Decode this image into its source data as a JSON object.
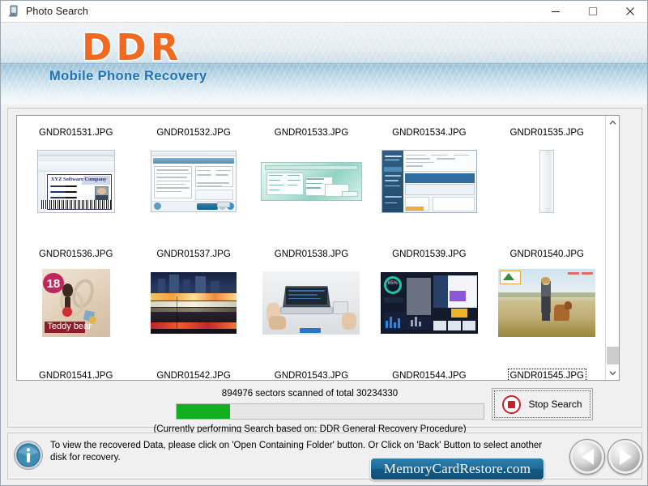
{
  "window": {
    "title": "Photo Search",
    "icon": "photo-search-app-icon",
    "controls": {
      "minimize": "minimize-icon",
      "maximize": "maximize-icon",
      "close": "close-icon"
    }
  },
  "banner": {
    "logo": "DDR",
    "subtitle": "Mobile Phone Recovery",
    "logo_color": "#f06a22",
    "subtitle_color": "#1d71b8"
  },
  "thumbnails": {
    "rows": [
      [
        {
          "label": "GNDR01531.JPG",
          "selected": false,
          "kind": "screenshot-idcard"
        },
        {
          "label": "GNDR01532.JPG",
          "selected": false,
          "kind": "screenshot-form"
        },
        {
          "label": "GNDR01533.JPG",
          "selected": false,
          "kind": "screenshot-teal"
        },
        {
          "label": "GNDR01534.JPG",
          "selected": false,
          "kind": "screenshot-blue-sidebar"
        },
        {
          "label": "GNDR01535.JPG",
          "selected": false,
          "kind": "screenshot-narrow"
        }
      ],
      [
        {
          "label": "GNDR01536.JPG",
          "selected": false,
          "kind": "photo-teddy"
        },
        {
          "label": "GNDR01537.JPG",
          "selected": false,
          "kind": "photo-city-traffic"
        },
        {
          "label": "GNDR01538.JPG",
          "selected": false,
          "kind": "photo-laptop-desk"
        },
        {
          "label": "GNDR01539.JPG",
          "selected": false,
          "kind": "screenshot-dashboard"
        },
        {
          "label": "GNDR01540.JPG",
          "selected": false,
          "kind": "photo-woman-dog"
        }
      ],
      [
        {
          "label": "GNDR01541.JPG",
          "selected": false,
          "kind": "photo-teddy"
        },
        {
          "label": "GNDR01542.JPG",
          "selected": false,
          "kind": "photo-city-traffic"
        },
        {
          "label": "GNDR01543.JPG",
          "selected": false,
          "kind": "photo-laptop-desk"
        },
        {
          "label": "GNDR01544.JPG",
          "selected": false,
          "kind": "screenshot-dashboard"
        },
        {
          "label": "GNDR01545.JPG",
          "selected": true,
          "kind": "photo-woman-dog"
        }
      ]
    ]
  },
  "scrollbar": {
    "up_icon": "chevron-up-icon",
    "down_icon": "chevron-down-icon",
    "thumb_position": "near-bottom"
  },
  "progress": {
    "status_text": "894976 sectors scanned of total 30234330",
    "sectors_scanned": 894976,
    "sectors_total": 30234330,
    "percent": 17.5,
    "fill_color": "#12b021",
    "sub_text": "(Currently performing Search based on:  DDR General Recovery Procedure)"
  },
  "stop_button": {
    "label": "Stop Search",
    "icon": "stop-icon",
    "icon_color": "#cc2027"
  },
  "footer": {
    "info_icon": "info-icon",
    "message": "To view the recovered Data, please click on 'Open Containing Folder' button. Or Click on 'Back' Button to select another disk for recovery.",
    "brand": "MemoryCardRestore.com",
    "back_button": "back-arrow-icon",
    "forward_button": "forward-arrow-icon"
  }
}
